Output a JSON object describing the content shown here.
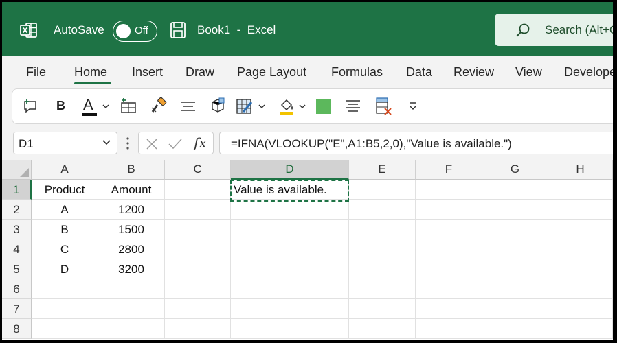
{
  "titlebar": {
    "autosave_label": "AutoSave",
    "autosave_state": "Off",
    "doc_title": "Book1  -  Excel",
    "search_placeholder": "Search (Alt+Q)",
    "bg_color": "#1e7345"
  },
  "menu": {
    "tabs": [
      "File",
      "Home",
      "Insert",
      "Draw",
      "Page Layout",
      "Formulas",
      "Data",
      "Review",
      "View",
      "Developer"
    ],
    "active": "Home"
  },
  "toolbar": {
    "bold_label": "B",
    "font_color_label": "A",
    "fill_swatch_color": "#5cb85c",
    "font_color_bar": "#111111",
    "icons": [
      "comment-icon",
      "bold-icon",
      "font-color-icon",
      "insert-icon",
      "format-painter-icon",
      "align-center-icon",
      "sheet-icon",
      "borders-icon",
      "fill-color-icon",
      "fill-swatch-icon",
      "align-icon",
      "clear-icon",
      "more-icon"
    ]
  },
  "formula_bar": {
    "name_box": "D1",
    "fx_label": "fx",
    "formula": "=IFNA(VLOOKUP(\"E\",A1:B5,2,0),\"Value is available.\")"
  },
  "grid": {
    "columns": [
      "A",
      "B",
      "C",
      "D",
      "E",
      "F",
      "G",
      "H"
    ],
    "selected_column": "D",
    "rows": [
      "1",
      "2",
      "3",
      "4",
      "5",
      "6",
      "7",
      "8"
    ],
    "selected_row": "1",
    "cells": {
      "A1": "Product",
      "B1": "Amount",
      "D1": "Value is available.",
      "A2": "A",
      "B2": "1200",
      "A3": "B",
      "B3": "1500",
      "A4": "C",
      "B4": "2800",
      "A5": "D",
      "B5": "3200"
    },
    "accent_color": "#1e7345"
  }
}
